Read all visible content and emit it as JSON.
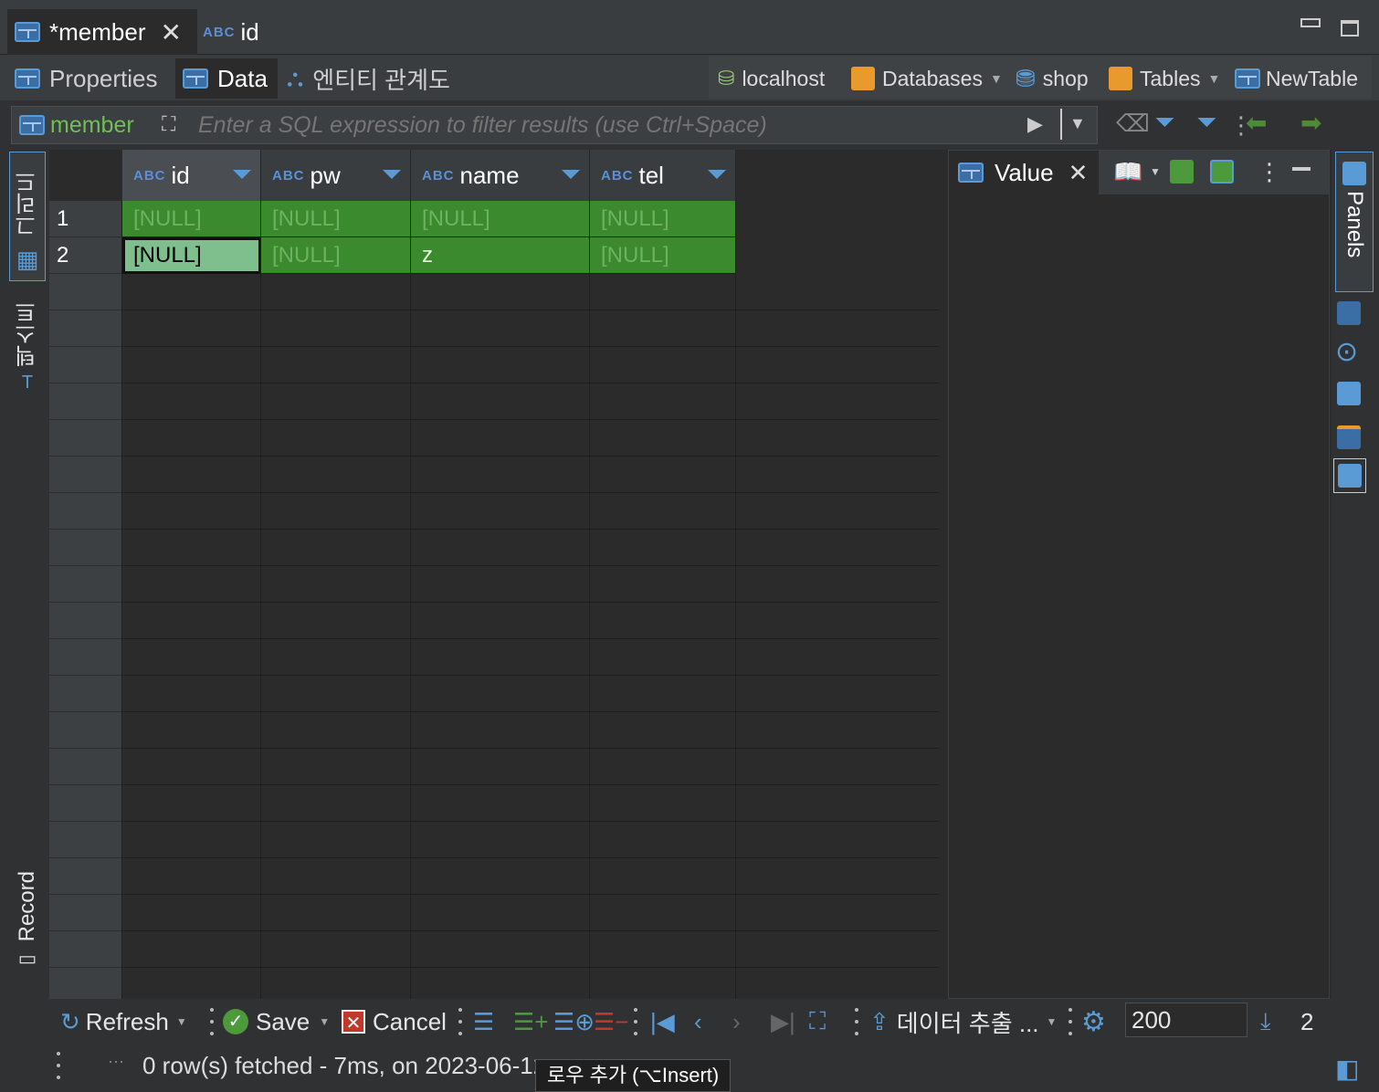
{
  "editor_tabs": [
    {
      "label": "*member",
      "active": true
    },
    {
      "label": "id",
      "type_badge": "ABC",
      "active": false
    }
  ],
  "sub_tabs": [
    {
      "label": "Properties"
    },
    {
      "label": "Data",
      "active": true
    },
    {
      "label": "엔티티 관계도"
    }
  ],
  "breadcrumb": [
    "localhost",
    "Databases",
    "shop",
    "Tables",
    "NewTable"
  ],
  "filter": {
    "table_label": "member",
    "placeholder": "Enter a SQL expression to filter results (use Ctrl+Space)"
  },
  "left_tabs": {
    "grid": "그리드",
    "text": "텍스트",
    "record": "Record"
  },
  "grid": {
    "type_badge": "ABC",
    "columns": [
      "id",
      "pw",
      "name",
      "tel"
    ],
    "rows": [
      {
        "num": "1",
        "cells": [
          "[NULL]",
          "[NULL]",
          "[NULL]",
          "[NULL]"
        ]
      },
      {
        "num": "2",
        "cells": [
          "[NULL]",
          "[NULL]",
          "z",
          "[NULL]"
        ]
      }
    ]
  },
  "value_panel": {
    "title": "Value"
  },
  "right_bar": {
    "panels_label": "Panels"
  },
  "bottom": {
    "refresh": "Refresh",
    "save": "Save",
    "cancel": "Cancel",
    "export": "데이터 추출 ...",
    "fetch_size": "200",
    "row_count": "2"
  },
  "status": {
    "message": "0 row(s) fetched - 7ms, on 2023-06-12 at 10:37:07",
    "tooltip": "로우 추가 (⌥Insert)"
  },
  "colors": {
    "accent": "#5b9bd5",
    "new_row": "#3b8a2d",
    "selected_cell": "#7fbf8e",
    "background": "#2b2b2b"
  }
}
